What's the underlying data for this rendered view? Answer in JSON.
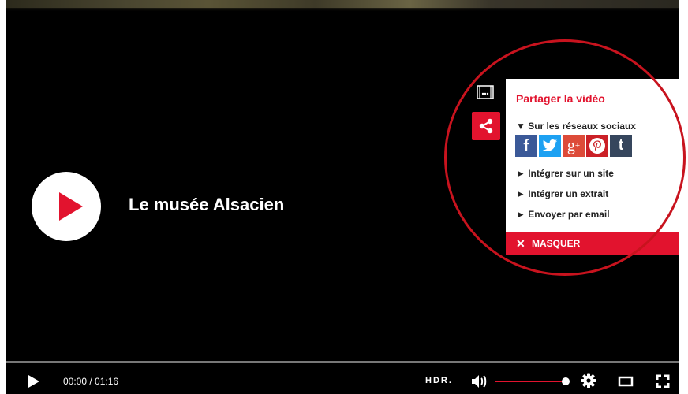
{
  "video": {
    "title": "Le musée Alsacien"
  },
  "share_panel": {
    "title": "Partager la vidéo",
    "social_section": "▼ Sur les réseaux sociaux",
    "social_icons": [
      "facebook-icon",
      "twitter-icon",
      "google-plus-icon",
      "pinterest-icon",
      "tumblr-icon"
    ],
    "items": [
      "► Intégrer sur un site",
      "► Intégrer un extrait",
      "► Envoyer par email"
    ],
    "hide_label": "MASQUER",
    "hide_icon": "✕"
  },
  "controls": {
    "time": "00:00 / 01:16",
    "quality": "HDR.",
    "progress_fraction": 0.0,
    "volume_fraction": 1.0
  },
  "colors": {
    "accent": "#e2132e",
    "annotation": "#c8131e"
  }
}
